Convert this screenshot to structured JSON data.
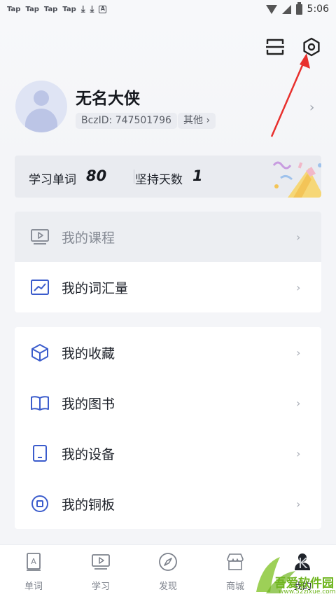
{
  "status_bar": {
    "left_items": [
      "Tap",
      "Tap",
      "Tap",
      "Tap"
    ],
    "time": "5:06"
  },
  "header": {
    "scan_icon": "scan-icon",
    "settings_icon": "settings-gear-icon"
  },
  "profile": {
    "name": "无名大侠",
    "id_label": "BczID: 747501796",
    "other_label": "其他 ›"
  },
  "stats": {
    "words_label": "学习单词",
    "words_value": "80",
    "days_label": "坚持天数",
    "days_value": "1"
  },
  "menu_group_1": [
    {
      "label": "我的课程",
      "icon": "course-video-icon"
    },
    {
      "label": "我的词汇量",
      "icon": "vocab-chart-icon"
    }
  ],
  "menu_group_2": [
    {
      "label": "我的收藏",
      "icon": "favorites-cube-icon"
    },
    {
      "label": "我的图书",
      "icon": "book-icon"
    },
    {
      "label": "我的设备",
      "icon": "device-icon"
    },
    {
      "label": "我的铜板",
      "icon": "coin-icon"
    }
  ],
  "bottom_nav": [
    {
      "label": "单词",
      "icon": "word-card-icon"
    },
    {
      "label": "学习",
      "icon": "study-video-icon"
    },
    {
      "label": "发现",
      "icon": "compass-icon"
    },
    {
      "label": "商城",
      "icon": "store-icon"
    },
    {
      "label": "我的",
      "icon": "profile-icon"
    }
  ],
  "watermark": {
    "main": "吾爱软件园",
    "url": "www.52zixue.com"
  },
  "colors": {
    "accent_blue": "#3b5ccc",
    "arrow_red": "#e8302d",
    "watermark_green": "#6fb51f"
  }
}
